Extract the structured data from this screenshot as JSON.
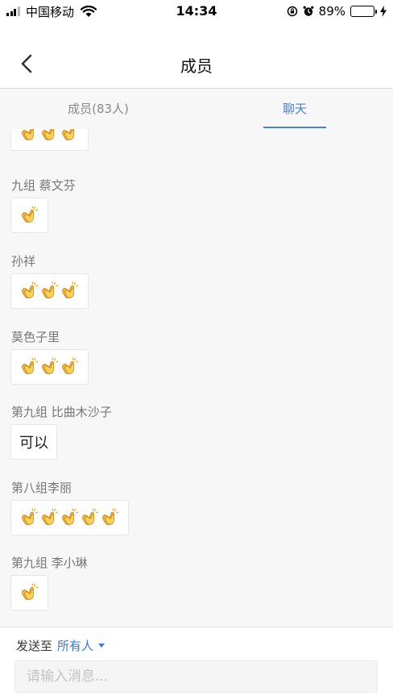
{
  "status_bar": {
    "carrier": "中国移动",
    "time": "14:34",
    "battery_percent": "89%",
    "battery_level": 0.89,
    "battery_color": "#33c759"
  },
  "nav": {
    "title": "成员",
    "back_icon": "chevron-left-icon"
  },
  "tabs": [
    {
      "label": "成员(83人)",
      "active": false
    },
    {
      "label": "聊天",
      "active": true
    }
  ],
  "accent_color": "#4a7fd6",
  "messages": [
    {
      "sender": "",
      "emoji": "👏",
      "count": 3
    },
    {
      "sender": "九组 蔡文芬",
      "emoji": "👏",
      "count": 1
    },
    {
      "sender": "孙祥",
      "emoji": "👏",
      "count": 3
    },
    {
      "sender": "莫色子里",
      "emoji": "👏",
      "count": 3
    },
    {
      "sender": "第九组 比曲木沙子",
      "text": "可以"
    },
    {
      "sender": "第八组李丽",
      "emoji": "👏",
      "count": 5
    },
    {
      "sender": "第九组   李小琳",
      "emoji": "👏",
      "count": 1
    }
  ],
  "composer": {
    "send_to_label": "发送至",
    "send_to_target": "所有人",
    "placeholder": "请输入消息..."
  }
}
